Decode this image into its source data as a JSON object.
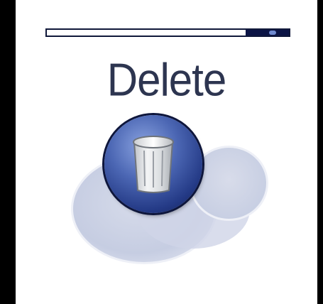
{
  "screen": {
    "title": "Delete"
  },
  "progress": {
    "value": 0.82,
    "fill_color": "#0b1445"
  },
  "icons": {
    "action_icon": "trash-can-icon"
  },
  "colors": {
    "title_text": "#2d3550",
    "button_blue": "#243a86",
    "halo": "#c8cfe3",
    "frame": "#000000"
  }
}
